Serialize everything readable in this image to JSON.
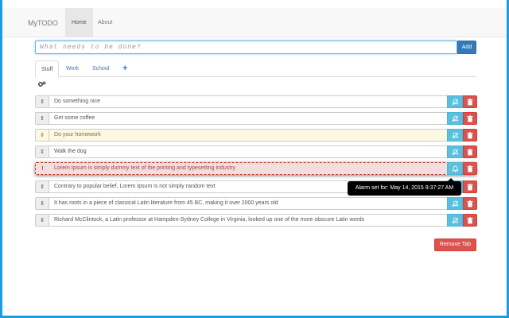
{
  "window": {
    "controls": [
      "minimize-icon",
      "maximize-icon",
      "close-icon"
    ]
  },
  "nav": {
    "brand": "MyTODO",
    "items": [
      {
        "label": "Home",
        "active": true
      },
      {
        "label": "About",
        "active": false
      }
    ]
  },
  "input": {
    "placeholder": "What needs to be done?",
    "add_label": "Add"
  },
  "tabs": [
    {
      "label": "Stuff",
      "active": true
    },
    {
      "label": "Work",
      "active": false
    },
    {
      "label": "School",
      "active": false
    },
    {
      "label": "+",
      "active": false
    }
  ],
  "todos": [
    {
      "text": "Do something nice",
      "state": "normal",
      "handle": "⇕"
    },
    {
      "text": "Get some coffee",
      "state": "normal",
      "handle": "⇕"
    },
    {
      "text": "Do your homework",
      "state": "warning",
      "handle": "⇕"
    },
    {
      "text": "Walk the dog",
      "state": "normal",
      "handle": "⇕"
    },
    {
      "text": "Lorem Ipsum is simply dummy text of the printing and typesetting industry",
      "state": "danger",
      "handle": "!"
    },
    {
      "text": "Contrary to popular belief, Lorem Ipsum is not simply random text",
      "state": "normal",
      "handle": "⇕"
    },
    {
      "text": "It has roots in a piece of classical Latin literature from 45 BC, making it over 2000 years old",
      "state": "normal",
      "handle": "⇕"
    },
    {
      "text": "Richard McClintock, a Latin professor at Hampden-Sydney College in Virginia, looked up one of the more obscure Latin words",
      "state": "normal",
      "handle": "⇕"
    }
  ],
  "tooltip": "Alarm set for: May 14, 2015 9:37:27 AM",
  "remove_tab_label": "Remove Tab",
  "colors": {
    "primary": "#337ab7",
    "info": "#5bc0de",
    "danger": "#d9534f",
    "warning_bg": "#fcf8e3",
    "danger_bg": "#f2dede",
    "chrome": "#1e9ae0"
  }
}
